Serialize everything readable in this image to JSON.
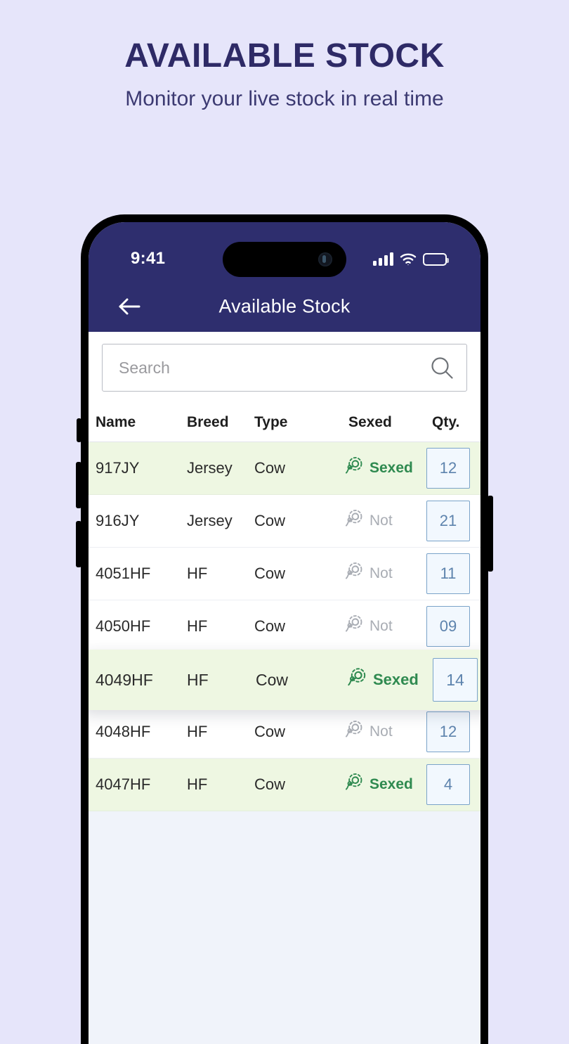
{
  "promo": {
    "title": "AVAILABLE STOCK",
    "subtitle": "Monitor your live stock in real time"
  },
  "status_bar": {
    "time": "9:41",
    "signal_icon": "cellular-signal-icon",
    "wifi_icon": "wifi-icon",
    "battery_icon": "battery-icon"
  },
  "app_bar": {
    "back_icon": "back-arrow-icon",
    "title": "Available Stock"
  },
  "search": {
    "placeholder": "Search",
    "value": "",
    "icon": "search-icon"
  },
  "table": {
    "columns": [
      "Name",
      "Breed",
      "Type",
      "Sexed",
      "Qty."
    ],
    "rows": [
      {
        "name": "917JY",
        "breed": "Jersey",
        "type": "Cow",
        "sexed": "Sexed",
        "sexed_state": "sexed",
        "qty": "12",
        "highlighted": true,
        "floating": false
      },
      {
        "name": "916JY",
        "breed": "Jersey",
        "type": "Cow",
        "sexed": "Not",
        "sexed_state": "not",
        "qty": "21",
        "highlighted": false,
        "floating": false
      },
      {
        "name": "4051HF",
        "breed": "HF",
        "type": "Cow",
        "sexed": "Not",
        "sexed_state": "not",
        "qty": "11",
        "highlighted": false,
        "floating": false
      },
      {
        "name": "4050HF",
        "breed": "HF",
        "type": "Cow",
        "sexed": "Not",
        "sexed_state": "not",
        "qty": "09",
        "highlighted": false,
        "floating": false
      },
      {
        "name": "4049HF",
        "breed": "HF",
        "type": "Cow",
        "sexed": "Sexed",
        "sexed_state": "sexed",
        "qty": "14",
        "highlighted": true,
        "floating": true
      },
      {
        "name": "4048HF",
        "breed": "HF",
        "type": "Cow",
        "sexed": "Not",
        "sexed_state": "not",
        "qty": "12",
        "highlighted": false,
        "floating": false
      },
      {
        "name": "4047HF",
        "breed": "HF",
        "type": "Cow",
        "sexed": "Sexed",
        "sexed_state": "sexed",
        "qty": "4",
        "highlighted": true,
        "floating": false
      }
    ]
  },
  "colors": {
    "page_background": "#e6e5fa",
    "brand_navy": "#2e2e6e",
    "row_highlight_green": "#eef7e2",
    "sexed_green": "#2f8a50",
    "not_gray": "#a9adb4",
    "qty_border_blue": "#7aa3c9",
    "qty_text_blue": "#5d83ad",
    "screen_empty": "#f0f3fa"
  }
}
